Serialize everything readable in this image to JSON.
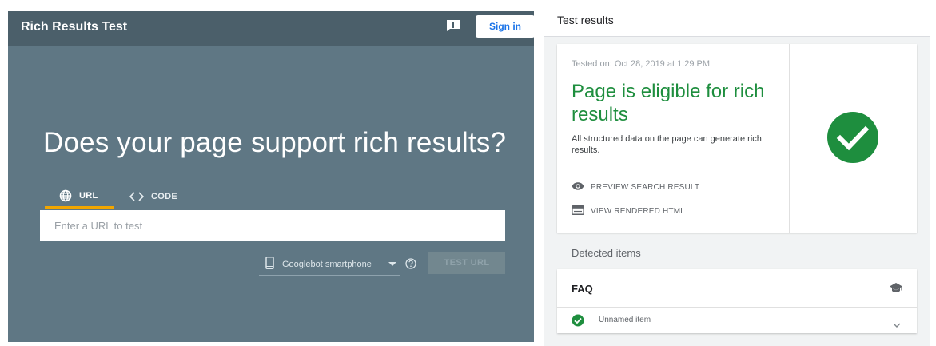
{
  "header": {
    "app_title": "Rich Results Test",
    "sign_in_label": "Sign in"
  },
  "main": {
    "headline": "Does your page support rich results?",
    "tabs": [
      {
        "label": "URL",
        "icon": "globe-icon",
        "selected": true
      },
      {
        "label": "CODE",
        "icon": "code-brackets-icon",
        "selected": false
      }
    ],
    "url_input": {
      "value": "",
      "placeholder": "Enter a URL to test"
    },
    "device_select": {
      "selected": "Googlebot smartphone",
      "icon": "smartphone-icon"
    },
    "test_button_label": "TEST URL"
  },
  "results": {
    "title": "Test results",
    "tested_on": "Tested on: Oct 28, 2019 at 1:29 PM",
    "status_title": "Page is eligible for rich results",
    "status_description": "All structured data on the page can generate rich results.",
    "actions": [
      {
        "label": "PREVIEW SEARCH RESULT",
        "icon": "eye-icon"
      },
      {
        "label": "VIEW RENDERED HTML",
        "icon": "web-page-icon"
      }
    ],
    "detected_label": "Detected items",
    "detected_items": [
      {
        "type": "FAQ",
        "icon": "school-icon",
        "entries": [
          {
            "label": "Unnamed item",
            "status": "valid"
          }
        ]
      }
    ]
  },
  "colors": {
    "left_background": "#5f7784",
    "top_bar": "#4b5f6a",
    "tab_indicator": "#f2a600",
    "success_green": "#1e8e3e",
    "link_blue": "#1a73e8"
  }
}
